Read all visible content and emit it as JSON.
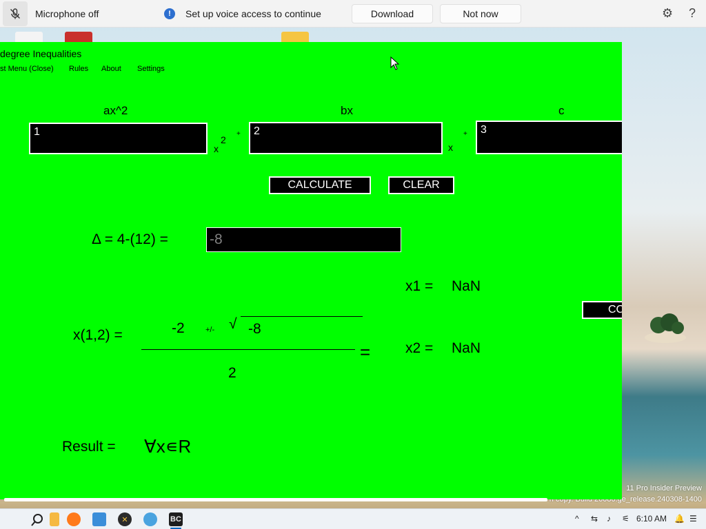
{
  "voice_access": {
    "mic_status": "Microphone off",
    "message": "Set up voice access to continue",
    "download_label": "Download",
    "not_now_label": "Not now"
  },
  "app": {
    "title": "degree Inequalities",
    "menu": [
      "st Menu (Close)",
      "Rules",
      "About",
      "Settings"
    ],
    "labels": {
      "a": "ax^2",
      "b": "bx",
      "c": "c"
    },
    "inputs": {
      "a": "1",
      "b": "2",
      "c": "3"
    },
    "term_suffix": {
      "x2_base": "x",
      "x2_exp": "2",
      "x": "x",
      "plus": "+"
    },
    "buttons": {
      "calculate": "CALCULATE",
      "clear": "CLEAR",
      "side": "CC"
    },
    "delta_label": "Δ = 4-(12) =",
    "delta_value": "-8",
    "formula": {
      "label": "x(1,2) =",
      "numerator_b": "-2",
      "plus_minus": "+/-",
      "sqrt_symbol": "√",
      "sqrt_value": "-8",
      "denominator": "2",
      "equals": "="
    },
    "roots": {
      "x1_label": "x1 =",
      "x1_value": "NaN",
      "x2_label": "x2 =",
      "x2_value": "NaN"
    },
    "result": {
      "label": "Result =",
      "value": "∀x∊R"
    }
  },
  "desktop": {
    "watermark_line1": "11 Pro Insider Preview",
    "watermark_line2": "n copy. Build 26080.ge_release.240308-1400"
  },
  "taskbar": {
    "time": "6:10 AM",
    "app_label": "BC",
    "colors": {
      "accent": "#0067c0",
      "app_bg": "#00ff00"
    }
  }
}
